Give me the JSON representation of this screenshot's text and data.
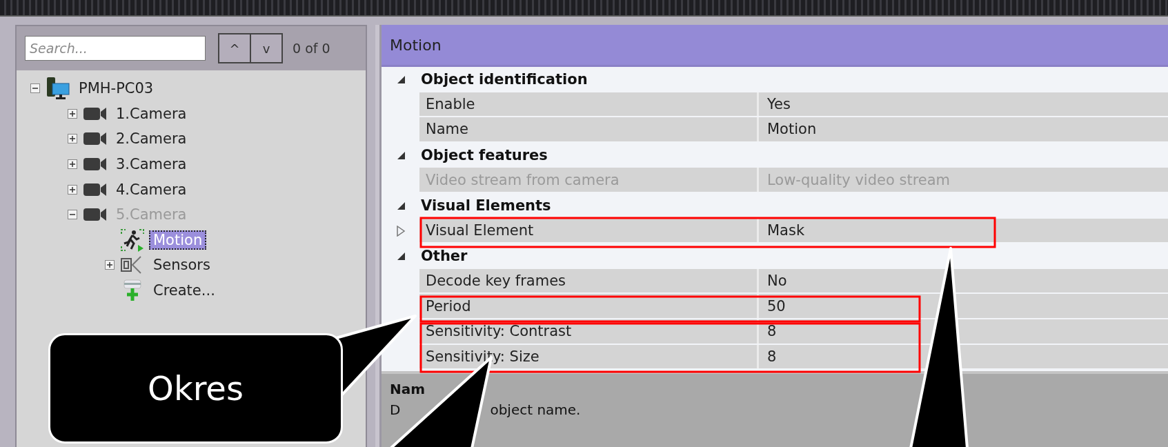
{
  "search": {
    "placeholder": "Search...",
    "up": "^",
    "down": "v",
    "count": "0 of 0"
  },
  "tree": [
    {
      "label": "PMH-PC03",
      "kind": "computer",
      "expanded": true,
      "selected": false,
      "disabled": false,
      "children": [
        {
          "label": "1.Camera",
          "kind": "camera",
          "expanded": false,
          "selected": false,
          "disabled": false
        },
        {
          "label": "2.Camera",
          "kind": "camera",
          "expanded": false,
          "selected": false,
          "disabled": false
        },
        {
          "label": "3.Camera",
          "kind": "camera",
          "expanded": false,
          "selected": false,
          "disabled": false
        },
        {
          "label": "4.Camera",
          "kind": "camera",
          "expanded": false,
          "selected": false,
          "disabled": false
        },
        {
          "label": "5.Camera",
          "kind": "camera",
          "expanded": true,
          "selected": false,
          "disabled": true,
          "children": [
            {
              "label": "Motion",
              "kind": "motion",
              "selected": true,
              "disabled": false
            },
            {
              "label": "Sensors",
              "kind": "sensors",
              "expanded": false,
              "selected": false,
              "disabled": false
            },
            {
              "label": "Create...",
              "kind": "create",
              "selected": false,
              "disabled": false
            }
          ]
        }
      ]
    }
  ],
  "panel": {
    "title": "Motion"
  },
  "sections": [
    {
      "title": "Object identification",
      "expanded": true,
      "rows": [
        {
          "label": "Enable",
          "value": "Yes",
          "disabled": false
        },
        {
          "label": "Name",
          "value": "Motion",
          "disabled": false
        }
      ]
    },
    {
      "title": "Object features",
      "expanded": true,
      "rows": [
        {
          "label": "Video stream from camera",
          "value": "Low-quality video stream",
          "disabled": true
        }
      ]
    },
    {
      "title": "Visual Elements",
      "expanded": true,
      "rows": [
        {
          "label": "Visual Element",
          "value": "Mask",
          "disabled": false,
          "expanded": false
        }
      ]
    },
    {
      "title": "Other",
      "expanded": true,
      "rows": [
        {
          "label": "Decode key frames",
          "value": "No",
          "disabled": false
        },
        {
          "label": "Period",
          "value": "50",
          "disabled": false
        },
        {
          "label": "Sensitivity: Contrast",
          "value": "8",
          "disabled": false
        },
        {
          "label": "Sensitivity: Size",
          "value": "8",
          "disabled": false
        }
      ]
    }
  ],
  "help": {
    "title": "Nam",
    "text_parts": [
      "D",
      "object name."
    ]
  },
  "callout": {
    "text": "Okres"
  }
}
